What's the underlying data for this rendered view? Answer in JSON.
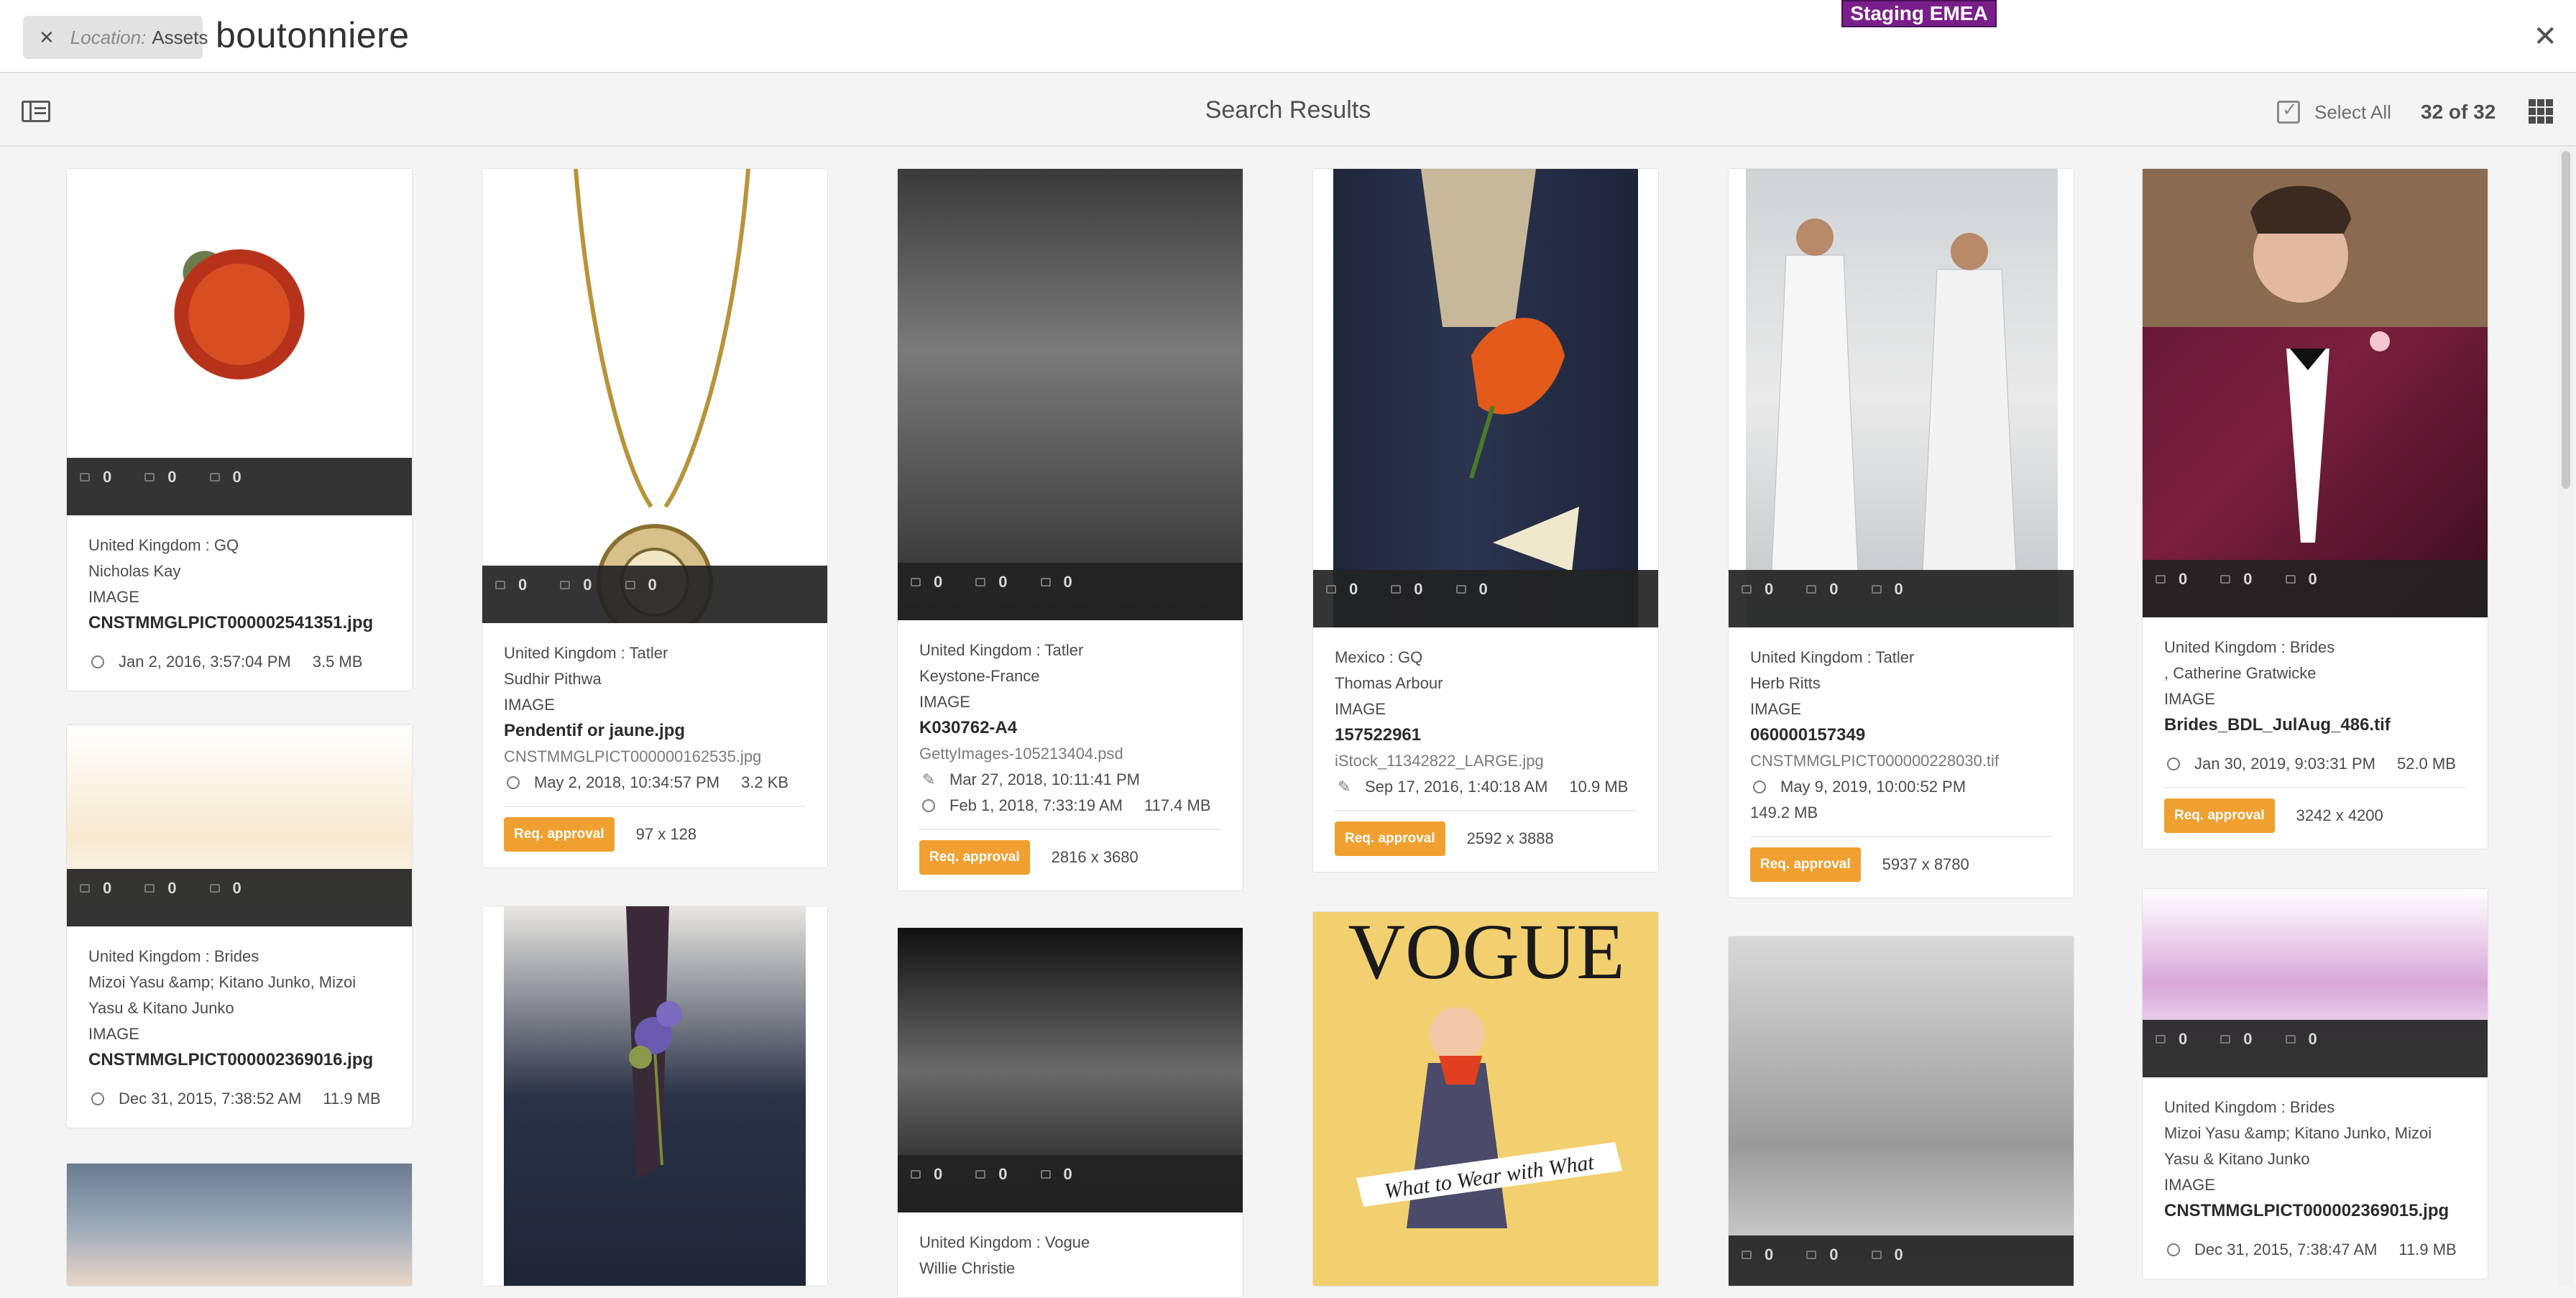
{
  "topbar": {
    "location_label": "Location:",
    "location_value": "Assets",
    "query": "boutonniere",
    "env_badge": "Staging EMEA",
    "env_color": "#7a1f8a"
  },
  "actionbar": {
    "title": "Search Results",
    "select_all": "Select All",
    "count": "32 of 32"
  },
  "cards": [
    {
      "stats": [
        "0",
        "0",
        "0"
      ],
      "line1": "United Kingdom :  GQ",
      "line2": "Nicholas Kay",
      "type": "IMAGE",
      "title": "CNSTMMGLPICT000002541351.jpg",
      "date": "Jan 2, 2016, 3:57:04 PM",
      "size": "3.5 MB"
    },
    {
      "stats": [
        "0",
        "0",
        "0"
      ],
      "line1": "United Kingdom :  Tatler",
      "line2": "Sudhir Pithwa",
      "type": "IMAGE",
      "title": "Pendentif or jaune.jpg",
      "subname": "CNSTMMGLPICT000000162535.jpg",
      "date": "May 2, 2018, 10:34:57 PM",
      "size": "3.2 KB",
      "badge": "Req. approval",
      "dims": "97 x 128"
    },
    {
      "stats": [
        "0",
        "0",
        "0"
      ],
      "line1": "United Kingdom :  Tatler",
      "line2": "Keystone-France",
      "type": "IMAGE",
      "title": "K030762-A4",
      "subname": "GettyImages-105213404.psd",
      "edited": "Mar 27, 2018, 10:11:41 PM",
      "date": "Feb 1, 2018, 7:33:19 AM",
      "size": "117.4 MB",
      "badge": "Req. approval",
      "dims": "2816 x 3680"
    },
    {
      "stats": [
        "0",
        "0",
        "0"
      ],
      "line1": "Mexico :  GQ",
      "line2": "Thomas Arbour",
      "type": "IMAGE",
      "title": "157522961",
      "subname": "iStock_11342822_LARGE.jpg",
      "edited": "Sep 17, 2016, 1:40:18 AM",
      "size": "10.9 MB",
      "badge": "Req. approval",
      "dims": "2592 x 3888"
    },
    {
      "stats": [
        "0",
        "0",
        "0"
      ],
      "line1": "United Kingdom :  Tatler",
      "line2": "Herb Ritts",
      "type": "IMAGE",
      "title": "060000157349",
      "subname": "CNSTMMGLPICT000000228030.tif",
      "date": "May 9, 2019, 10:00:52 PM",
      "size": "149.2 MB",
      "badge": "Req. approval",
      "dims": "5937 x 8780"
    },
    {
      "stats": [
        "0",
        "0",
        "0"
      ],
      "line1": "United Kingdom :  Brides",
      "line2": ", Catherine Gratwicke",
      "type": "IMAGE",
      "title": "Brides_BDL_JulAug_486.tif",
      "date": "Jan 30, 2019, 9:03:31 PM",
      "size": "52.0 MB",
      "badge": "Req. approval",
      "dims": "3242 x 4200"
    },
    {
      "stats": [
        "0",
        "0",
        "0"
      ],
      "line1": "United Kingdom :  Brides",
      "line2": "Mizoi Yasu &amp; Kitano Junko, Mizoi Yasu & Kitano Junko",
      "type": "IMAGE",
      "title": "CNSTMMGLPICT000002369016.jpg",
      "date": "Dec 31, 2015, 7:38:52 AM",
      "size": "11.9 MB"
    },
    {
      "stats": [
        "0",
        "0",
        "0"
      ],
      "line1": "United Kingdom :  Vogue",
      "line2": "Willie Christie"
    },
    {
      "stats": [
        "0",
        "0",
        "0"
      ]
    },
    {
      "stats": [
        "0",
        "0",
        "0"
      ],
      "line1": "United Kingdom :  Brides",
      "line2": "Mizoi Yasu &amp; Kitano Junko, Mizoi Yasu & Kitano Junko",
      "type": "IMAGE",
      "title": "CNSTMMGLPICT000002369015.jpg",
      "date": "Dec 31, 2015, 7:38:47 AM",
      "size": "11.9 MB"
    },
    {
      "vogue_masthead": "VOGUE",
      "vogue_banner": "What to Wear with What"
    }
  ]
}
